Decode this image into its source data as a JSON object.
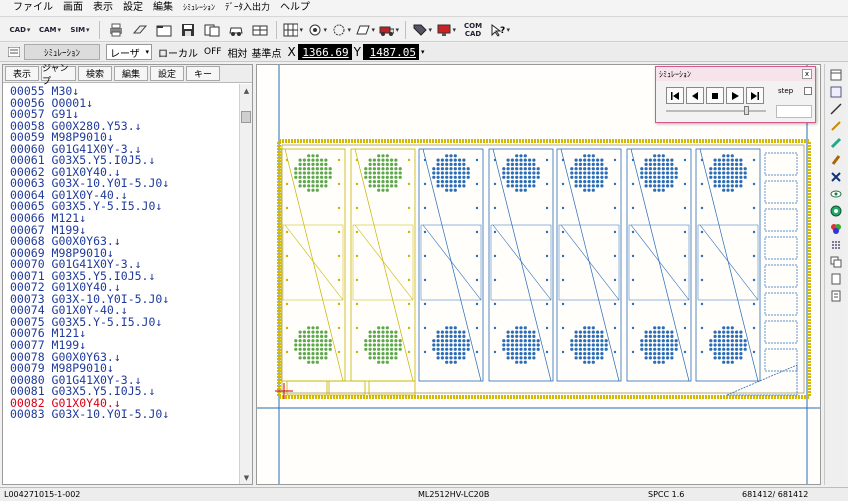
{
  "menu": [
    "ファイル",
    "画面",
    "表示",
    "設定",
    "編集",
    "ｼﾐｭﾚｰｼｮﾝ",
    "ﾃﾞｰﾀ入出力",
    "ヘルプ"
  ],
  "toolbar": {
    "cad_label": "CAD",
    "cam_label": "CAM",
    "sim_label": "SIM",
    "comcad_label": "COM CAD"
  },
  "simbar": {
    "tab_label": "ｼﾐｭﾚｰｼｮﾝ",
    "mode_value": "レーザ",
    "local_label": "ローカル",
    "off_label": "OFF",
    "relative_label": "相対",
    "origin_label": "基準点",
    "x_label": "X",
    "x_value": "1366.69",
    "y_label": "Y",
    "y_value": "1487.05"
  },
  "left_tabs": [
    "表示",
    "ジャンプ",
    "検索",
    "編集",
    "設定",
    "キー"
  ],
  "code_lines": [
    "00055 M30↓",
    "00056 O0001↓",
    "00057 G91↓",
    "00058 G00X280.Y53.↓",
    "00059 M98P9010↓",
    "00060 G01G41X0Y-3.↓",
    "00061 G03X5.Y5.I0J5.↓",
    "00062 G01X0Y40.↓",
    "00063 G03X-10.Y0I-5.J0↓",
    "00064 G01X0Y-40.↓",
    "00065 G03X5.Y-5.I5.J0↓",
    "00066 M121↓",
    "00067 M199↓",
    "00068 G00X0Y63.↓",
    "00069 M98P9010↓",
    "00070 G01G41X0Y-3.↓",
    "00071 G03X5.Y5.I0J5.↓",
    "00072 G01X0Y40.↓",
    "00073 G03X-10.Y0I-5.J0↓",
    "00074 G01X0Y-40.↓",
    "00075 G03X5.Y-5.I5.J0↓",
    "00076 M121↓",
    "00077 M199↓",
    "00078 G00X0Y63.↓",
    "00079 M98P9010↓",
    "00080 G01G41X0Y-3.↓",
    "00081 G03X5.Y5.I0J5.↓",
    "00082 G01X0Y40.↓",
    "00083 G03X-10.Y0I-5.J0↓"
  ],
  "current_line_index": 27,
  "sim_window": {
    "title": "ｼﾐｭﾚｰｼｮﾝ",
    "step_label": "step",
    "close_label": "x",
    "slider_fraction": 0.8
  },
  "status": {
    "left": "L004271015-1-002",
    "machine": "ML2512HV-LC20B",
    "material": "SPCC 1.6",
    "count": "681412/ 681412"
  },
  "colors": {
    "path_blue": "#2a6cb8",
    "path_yellow": "#c8b400",
    "hole_green": "#5ca84a",
    "sheet_border": "#d4b800",
    "code_text": "#1f3a9a",
    "current_line": "#d8001a"
  }
}
